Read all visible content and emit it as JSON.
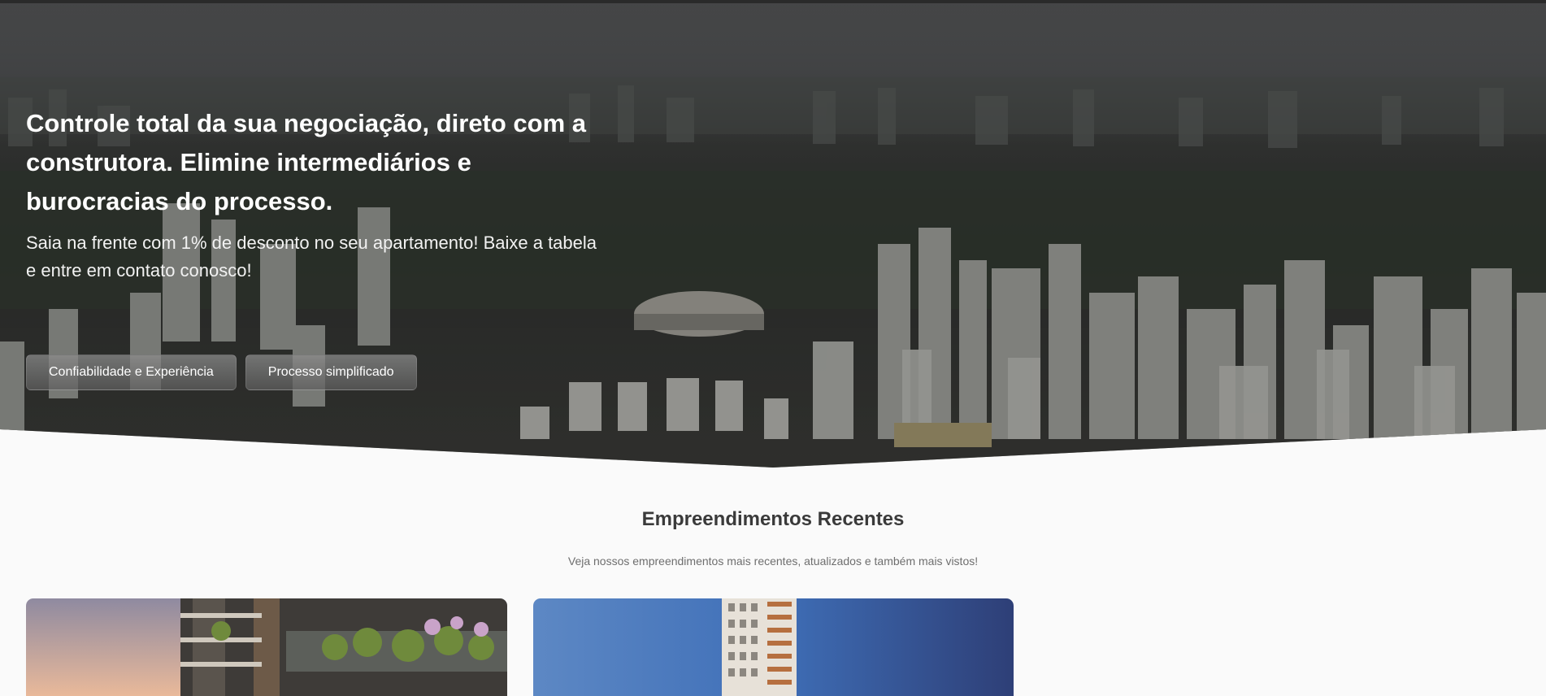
{
  "hero": {
    "title": "Controle total da sua negociação, direto com a construtora. Elimine intermediários e burocracias do processo.",
    "subtitle": "Saia na frente com 1% de desconto no seu apartamento! Baixe a tabela e entre em contato conosco!",
    "buttons": [
      {
        "label": "Confiabilidade e Experiência"
      },
      {
        "label": "Processo simplificado"
      }
    ]
  },
  "recent": {
    "title": "Empreendimentos Recentes",
    "subtitle": "Veja nossos empreendimentos mais recentes, atualizados e também mais vistos!"
  },
  "cards": [
    {
      "image": "building-balcony-photo"
    },
    {
      "image": "tower-sky-photo"
    }
  ],
  "colors": {
    "page_background": "#fafafa",
    "heading": "#3a3a3a",
    "muted_text": "#6e6e6e",
    "hero_text": "#ffffff"
  }
}
